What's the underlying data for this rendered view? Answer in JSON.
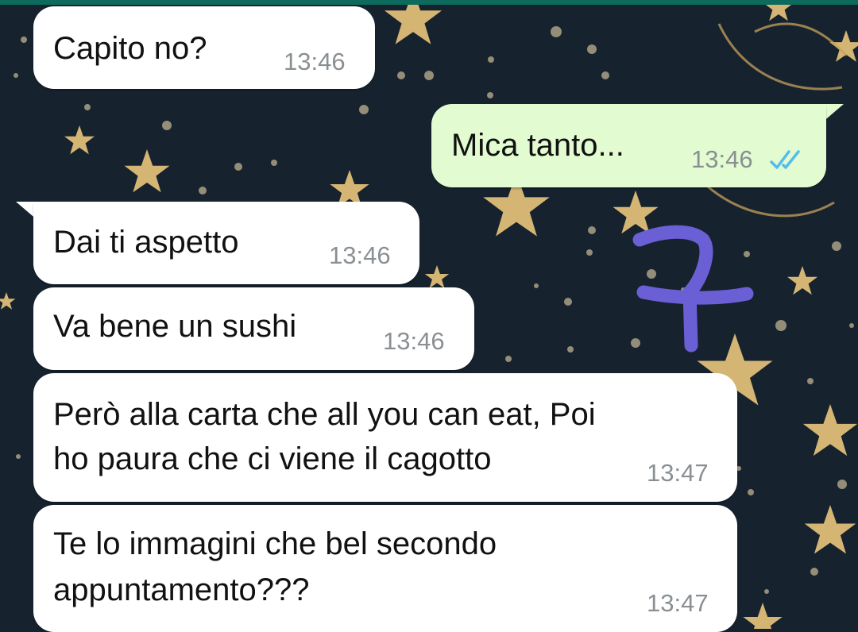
{
  "chat": {
    "messages": [
      {
        "direction": "incoming",
        "text": [
          "Capito no?"
        ],
        "time": "13:46"
      },
      {
        "direction": "outgoing",
        "text": [
          "Mica tanto..."
        ],
        "time": "13:46",
        "status": "read"
      },
      {
        "direction": "incoming",
        "text": [
          "Dai ti aspetto"
        ],
        "time": "13:46"
      },
      {
        "direction": "incoming",
        "text": [
          "Va bene un sushi"
        ],
        "time": "13:46"
      },
      {
        "direction": "incoming",
        "text": [
          "Però alla carta che all you can eat, Poi",
          "ho paura che ci viene il cagotto"
        ],
        "time": "13:47"
      },
      {
        "direction": "incoming",
        "text": [
          "Te lo immagini che bel secondo",
          "appuntamento???"
        ],
        "time": "13:47"
      }
    ]
  },
  "colors": {
    "wallpaper": "#16232f",
    "incoming_bubble": "#ffffff",
    "outgoing_bubble": "#e2fbd0",
    "read_ticks": "#53bdeb",
    "stars": "#e7c27a",
    "annotation": "#6b5fd6"
  },
  "icons": {
    "read_receipt": "double-check-icon",
    "annotation": "purple-number-seven-scribble"
  }
}
